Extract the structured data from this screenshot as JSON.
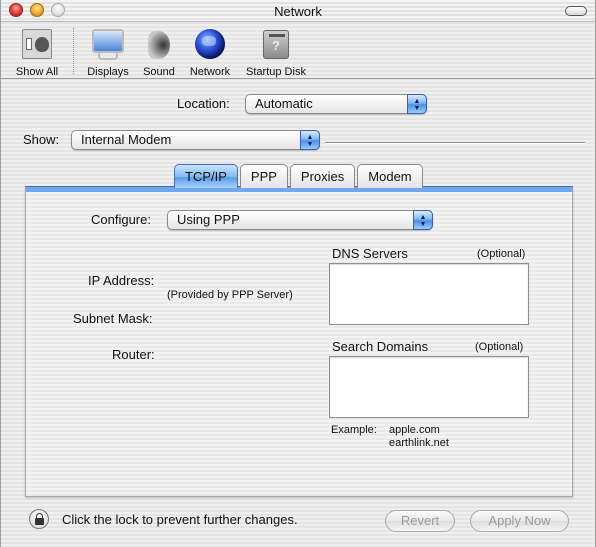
{
  "window": {
    "title": "Network"
  },
  "toolbar": {
    "items": [
      {
        "label": "Show All",
        "icon": "show-all-icon"
      },
      {
        "label": "Displays",
        "icon": "displays-icon"
      },
      {
        "label": "Sound",
        "icon": "sound-icon"
      },
      {
        "label": "Network",
        "icon": "network-globe-icon"
      },
      {
        "label": "Startup Disk",
        "icon": "startup-disk-icon"
      }
    ]
  },
  "location": {
    "label": "Location:",
    "value": "Automatic"
  },
  "show": {
    "label": "Show:",
    "value": "Internal Modem"
  },
  "tabs": [
    {
      "label": "TCP/IP",
      "active": true
    },
    {
      "label": "PPP",
      "active": false
    },
    {
      "label": "Proxies",
      "active": false
    },
    {
      "label": "Modem",
      "active": false
    }
  ],
  "tcpip": {
    "configure_label": "Configure:",
    "configure_value": "Using PPP",
    "ip_address_label": "IP Address:",
    "provided_note": "(Provided by PPP Server)",
    "subnet_mask_label": "Subnet Mask:",
    "router_label": "Router:",
    "dns_servers_label": "DNS Servers",
    "dns_optional": "(Optional)",
    "dns_servers_value": "",
    "search_domains_label": "Search Domains",
    "search_optional": "(Optional)",
    "search_domains_value": "",
    "example_label": "Example:",
    "example_values": [
      "apple.com",
      "earthlink.net"
    ]
  },
  "footer": {
    "lock_text": "Click the lock to prevent further changes.",
    "revert_label": "Revert",
    "apply_label": "Apply Now"
  },
  "colors": {
    "accent_blue": "#6fa8ec",
    "disabled_text": "#9a9a9a"
  }
}
